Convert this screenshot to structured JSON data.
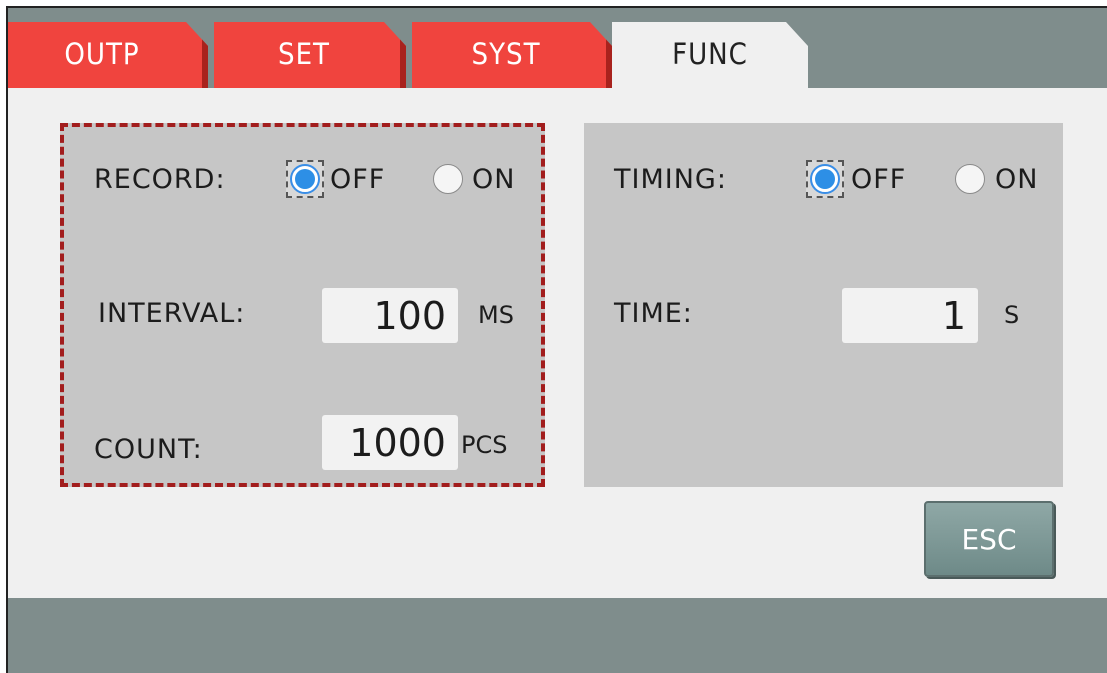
{
  "tabs": [
    {
      "label": "OUTP",
      "active": false
    },
    {
      "label": "SET",
      "active": false
    },
    {
      "label": "SYST",
      "active": false
    },
    {
      "label": "FUNC",
      "active": true
    }
  ],
  "record": {
    "label": "RECORD:",
    "options": [
      {
        "label": "OFF",
        "selected": true
      },
      {
        "label": "ON",
        "selected": false
      }
    ],
    "interval": {
      "label": "INTERVAL:",
      "value": "100",
      "unit": "MS"
    },
    "count": {
      "label": "COUNT:",
      "value": "1000",
      "unit": "PCS"
    }
  },
  "timing": {
    "label": "TIMING:",
    "options": [
      {
        "label": "OFF",
        "selected": true
      },
      {
        "label": "ON",
        "selected": false
      }
    ],
    "time": {
      "label": "TIME:",
      "value": "1",
      "unit": "S"
    }
  },
  "esc_label": "ESC",
  "colors": {
    "tab_red": "#f0443e",
    "panel_gray": "#c6c6c6",
    "focus_border": "#a21d1d",
    "radio_blue": "#2d8fe6",
    "frame": "#7f8d8c"
  }
}
